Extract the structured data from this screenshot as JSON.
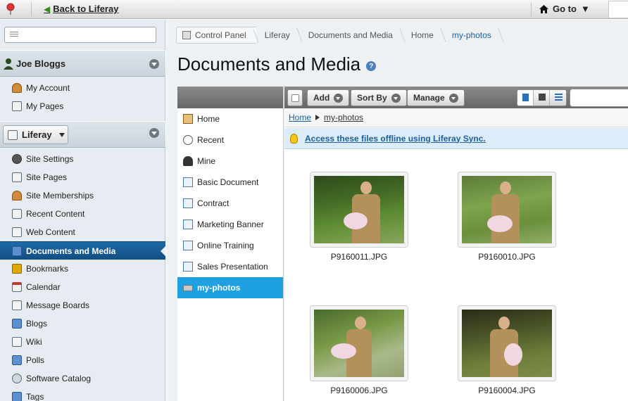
{
  "topbar": {
    "back_label": "Back to Liferay",
    "goto_label": "Go to"
  },
  "sidebar": {
    "user_name": "Joe Bloggs",
    "user_items": [
      {
        "label": "My Account"
      },
      {
        "label": "My Pages"
      }
    ],
    "site_name": "Liferay",
    "site_items": [
      {
        "label": "Site Settings"
      },
      {
        "label": "Site Pages"
      },
      {
        "label": "Site Memberships"
      },
      {
        "label": "Recent Content"
      },
      {
        "label": "Web Content"
      },
      {
        "label": "Documents and Media",
        "active": true
      },
      {
        "label": "Bookmarks"
      },
      {
        "label": "Calendar"
      },
      {
        "label": "Message Boards"
      },
      {
        "label": "Blogs"
      },
      {
        "label": "Wiki"
      },
      {
        "label": "Polls"
      },
      {
        "label": "Software Catalog"
      },
      {
        "label": "Tags"
      }
    ]
  },
  "breadcrumb": [
    "Control Panel",
    "Liferay",
    "Documents and Media",
    "Home",
    "my-photos"
  ],
  "page_title": "Documents and Media",
  "folders": [
    {
      "label": "Home",
      "icon": "home-icon"
    },
    {
      "label": "Recent",
      "icon": "clock-icon"
    },
    {
      "label": "Mine",
      "icon": "person-icon"
    },
    {
      "label": "Basic Document",
      "icon": "document-type-icon"
    },
    {
      "label": "Contract",
      "icon": "document-type-icon"
    },
    {
      "label": "Marketing Banner",
      "icon": "document-type-icon"
    },
    {
      "label": "Online Training",
      "icon": "document-type-icon"
    },
    {
      "label": "Sales Presentation",
      "icon": "document-type-icon"
    },
    {
      "label": "my-photos",
      "icon": "drive-icon",
      "active": true
    }
  ],
  "toolbar": {
    "add_label": "Add",
    "sort_label": "Sort By",
    "manage_label": "Manage"
  },
  "path": {
    "home": "Home",
    "current": "my-photos"
  },
  "sync_message": "Access these files offline using Liferay Sync.",
  "files": [
    {
      "name": "P9160011.JPG"
    },
    {
      "name": "P9160010.JPG"
    },
    {
      "name": "P9160006.JPG"
    },
    {
      "name": "P9160004.JPG"
    }
  ]
}
